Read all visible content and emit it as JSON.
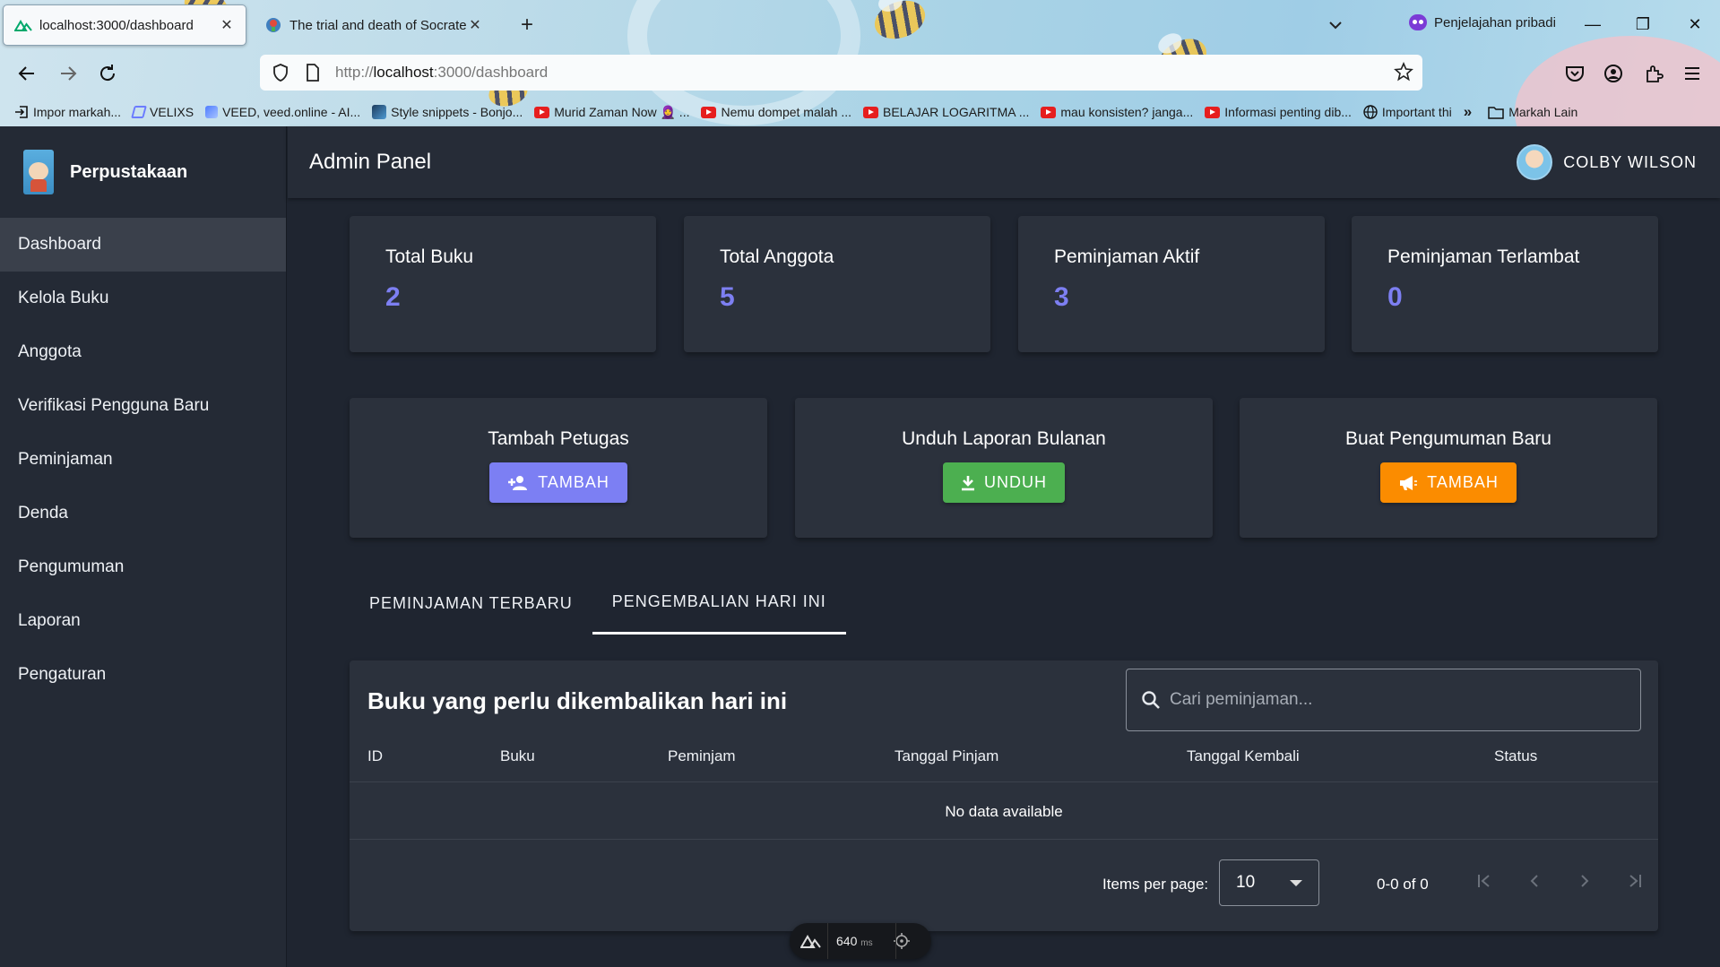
{
  "browser": {
    "tabs": [
      {
        "title": "localhost:3000/dashboard",
        "active": true
      },
      {
        "title": "The trial and death of Socrates",
        "active": false
      }
    ],
    "private_label": "Penjelajahan pribadi",
    "url_prefix": "http://",
    "url_host": "localhost",
    "url_rest": ":3000/dashboard",
    "bookmarks": [
      {
        "label": "Impor markah...",
        "icon": "import-icon"
      },
      {
        "label": "VELIXS",
        "icon": "velixs-icon"
      },
      {
        "label": "VEED, veed.online - AI...",
        "icon": "veed-icon"
      },
      {
        "label": "Style snippets - Bonjo...",
        "icon": "bonjo-icon"
      },
      {
        "label": "Murid Zaman Now 🧕 ...",
        "icon": "youtube-icon"
      },
      {
        "label": "Nemu dompet malah ...",
        "icon": "youtube-icon"
      },
      {
        "label": "BELAJAR LOGARITMA ...",
        "icon": "youtube-icon"
      },
      {
        "label": "mau konsisten? janga...",
        "icon": "youtube-icon"
      },
      {
        "label": "Informasi penting dib...",
        "icon": "youtube-icon"
      },
      {
        "label": "Important thi",
        "icon": "globe-icon"
      }
    ],
    "other_bookmarks": "Markah Lain"
  },
  "sidebar": {
    "brand": "Perpustakaan",
    "items": [
      {
        "label": "Dashboard",
        "active": true
      },
      {
        "label": "Kelola Buku"
      },
      {
        "label": "Anggota"
      },
      {
        "label": "Verifikasi Pengguna Baru"
      },
      {
        "label": "Peminjaman"
      },
      {
        "label": "Denda"
      },
      {
        "label": "Pengumuman"
      },
      {
        "label": "Laporan"
      },
      {
        "label": "Pengaturan"
      }
    ]
  },
  "header": {
    "title": "Admin Panel",
    "user_name": "COLBY WILSON"
  },
  "stats": [
    {
      "label": "Total Buku",
      "value": "2"
    },
    {
      "label": "Total Anggota",
      "value": "5"
    },
    {
      "label": "Peminjaman Aktif",
      "value": "3"
    },
    {
      "label": "Peminjaman Terlambat",
      "value": "0"
    }
  ],
  "actions": [
    {
      "title": "Tambah Petugas",
      "button": "TAMBAH",
      "color": "#7c7ff3",
      "icon": "add-user-icon"
    },
    {
      "title": "Unduh Laporan Bulanan",
      "button": "UNDUH",
      "color": "#4caf50",
      "icon": "download-icon"
    },
    {
      "title": "Buat Pengumuman Baru",
      "button": "TAMBAH",
      "color": "#fb8c00",
      "icon": "megaphone-icon"
    }
  ],
  "tabs": [
    {
      "label": "PEMINJAMAN TERBARU",
      "active": false
    },
    {
      "label": "PENGEMBALIAN HARI INI",
      "active": true
    }
  ],
  "table": {
    "title": "Buku yang perlu dikembalikan hari ini",
    "search_placeholder": "Cari peminjaman...",
    "columns": [
      "ID",
      "Buku",
      "Peminjam",
      "Tanggal Pinjam",
      "Tanggal Kembali",
      "Status"
    ],
    "empty_text": "No data available",
    "items_per_page_label": "Items per page:",
    "items_per_page": "10",
    "range": "0-0 of 0"
  },
  "devtools": {
    "time": "640",
    "unit": "ms"
  },
  "colors": {
    "accent": "#7d7ff2",
    "sidebar_bg": "#242a35",
    "card_bg": "#2b313c"
  }
}
